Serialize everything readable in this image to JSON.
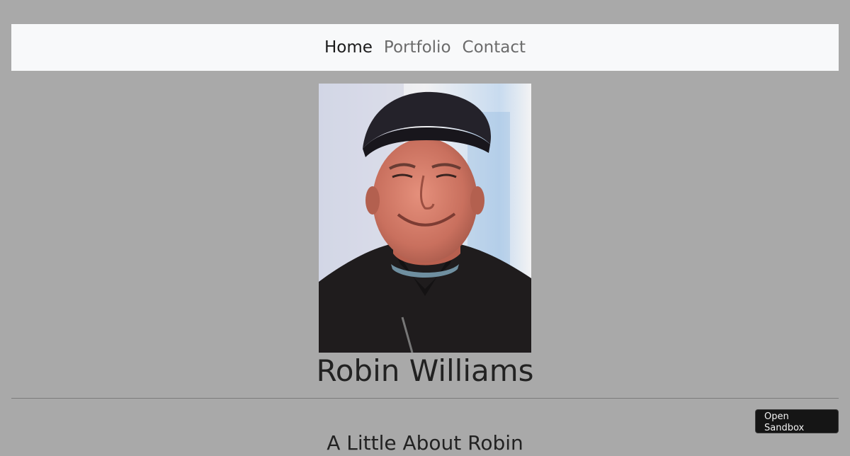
{
  "nav": {
    "items": [
      {
        "label": "Home",
        "active": true
      },
      {
        "label": "Portfolio",
        "active": false
      },
      {
        "label": "Contact",
        "active": false
      }
    ]
  },
  "profile": {
    "name": "Robin Williams"
  },
  "about": {
    "heading": "A Little About Robin"
  },
  "sandbox": {
    "button_label": "Open Sandbox"
  },
  "colors": {
    "page_background": "#a9a9a9",
    "navbar_background": "#f8f9fa",
    "nav_active": "#1b1b1b",
    "nav_inactive": "#6b6b6b",
    "sandbox_button": "#151515"
  }
}
